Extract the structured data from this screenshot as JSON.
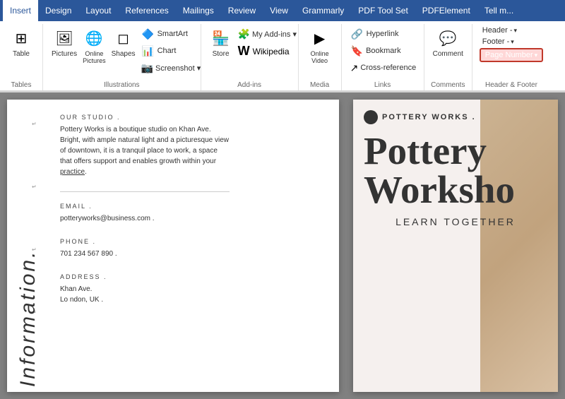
{
  "tabs": [
    {
      "label": "Insert",
      "active": true
    },
    {
      "label": "Design",
      "active": false
    },
    {
      "label": "Layout",
      "active": false
    },
    {
      "label": "References",
      "active": false
    },
    {
      "label": "Mailings",
      "active": false
    },
    {
      "label": "Review",
      "active": false
    },
    {
      "label": "View",
      "active": false
    },
    {
      "label": "Grammarly",
      "active": false
    },
    {
      "label": "PDF Tool Set",
      "active": false
    },
    {
      "label": "PDFElement",
      "active": false
    },
    {
      "label": "Tell m...",
      "active": false
    }
  ],
  "ribbon": {
    "groups": [
      {
        "name": "Tables",
        "items": [
          {
            "label": "Table",
            "icon": "⊞"
          }
        ]
      },
      {
        "name": "Illustrations",
        "items": [
          {
            "label": "Pictures",
            "icon": "🖼"
          },
          {
            "label": "Online\nPictures",
            "icon": "🌐"
          },
          {
            "label": "Shapes",
            "icon": "◻"
          },
          {
            "label": "Chart",
            "icon": "📊"
          },
          {
            "label": "Screenshot",
            "icon": "📷",
            "arrow": true
          },
          {
            "label": "SmartArt",
            "icon": "🔷"
          }
        ]
      },
      {
        "name": "Add-ins",
        "items": [
          {
            "label": "Store",
            "icon": "🏪"
          },
          {
            "label": "My Add-ins",
            "icon": "🧩",
            "arrow": true
          },
          {
            "label": "Wikipedia",
            "icon": "W"
          }
        ]
      },
      {
        "name": "Media",
        "items": [
          {
            "label": "Online\nVideo",
            "icon": "▶"
          }
        ]
      },
      {
        "name": "Links",
        "items": [
          {
            "label": "Hyperlink",
            "icon": "🔗"
          },
          {
            "label": "Bookmark",
            "icon": "🔖"
          },
          {
            "label": "Cross-reference",
            "icon": "↗"
          }
        ]
      },
      {
        "name": "Comments",
        "items": [
          {
            "label": "Comment",
            "icon": "💬"
          }
        ]
      },
      {
        "name": "Header & Footer",
        "items": [
          {
            "label": "Header",
            "arrow": true
          },
          {
            "label": "Footer",
            "arrow": true
          },
          {
            "label": "Page Number",
            "arrow": true,
            "highlighted": true
          }
        ]
      }
    ],
    "header_label": "Header -",
    "footer_label": "Footer -",
    "page_number_label": "Page Number"
  },
  "document": {
    "left_page": {
      "rotated_title": "Information.",
      "studio_heading": "OUR STUDIO .",
      "studio_text": "Pottery Works is a boutique studio on Khan Ave. Bright, with ample natural light and a picturesque view of downtown, it is a tranquil place to work, a space that offers support and enables growth within your practice.",
      "email_heading": "EMAIL .",
      "email_value": "potteryworks@business.com .",
      "phone_heading": "PHONE .",
      "phone_value": "701 234 567 890 .",
      "address_heading": "ADDRESS .",
      "address_line1": "Khan Ave.",
      "address_line2": "Lo ndon, UK ."
    },
    "right_page": {
      "logo_text": "POTTERY WORKS .",
      "main_title": "Pottery\nWorksho",
      "subtitle": "LEARN TOGETHER"
    }
  }
}
